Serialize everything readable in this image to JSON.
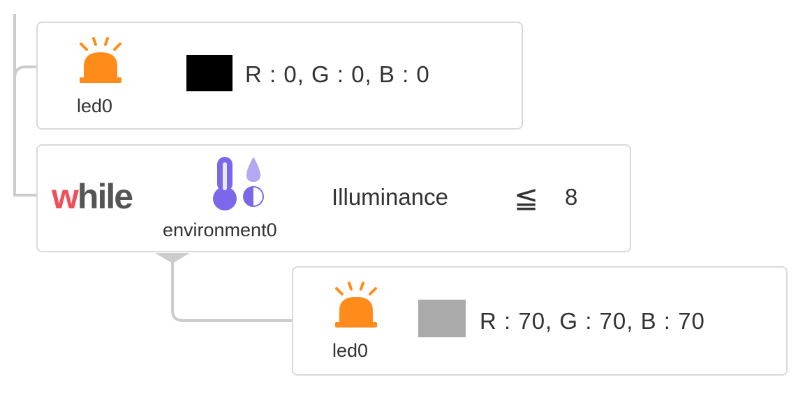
{
  "blocks": [
    {
      "type": "led",
      "device": "led0",
      "icon": "alarm-light-icon",
      "color": "#000000",
      "rgb_text": "R : 0, G : 0, B : 0"
    },
    {
      "type": "while",
      "keyword_first": "w",
      "keyword_rest": "hile",
      "device": "environment0",
      "icon": "temperature-humidity-icon",
      "sensor": "Illuminance",
      "operator": "≦",
      "value": "8"
    },
    {
      "type": "led",
      "device": "led0",
      "icon": "alarm-light-icon",
      "color": "#aaaaaa",
      "rgb_text": "R : 70, G : 70, B : 70"
    }
  ],
  "colors": {
    "led_icon": "#ff8c1a",
    "while_accent": "#f0505a",
    "sensor_icon": "#7b68e8",
    "sensor_icon_light": "#b3a8f2",
    "connector": "#cccccc"
  }
}
